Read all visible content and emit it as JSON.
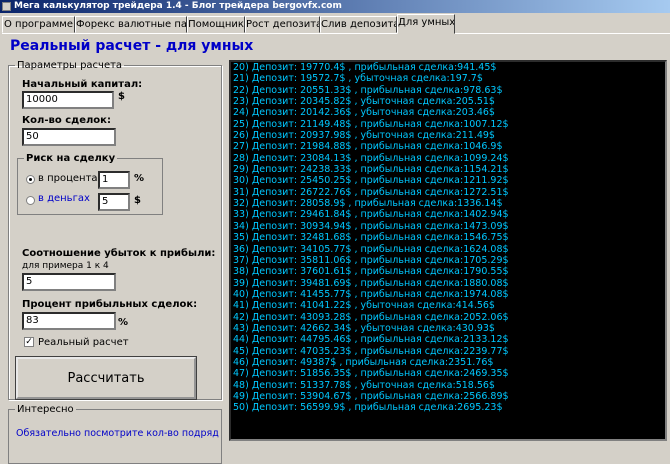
{
  "window": {
    "title": "Мега калькулятор трейдера 1.4 - Блог трейдера bergovfx.com"
  },
  "tabs": [
    {
      "label": "О программе"
    },
    {
      "label": "Форекс валютные пары"
    },
    {
      "label": "Помощник"
    },
    {
      "label": "Рост депозита"
    },
    {
      "label": "Слив депозита"
    },
    {
      "label": "Для умных"
    }
  ],
  "page": {
    "heading": "Реальный расчет - для умных"
  },
  "params": {
    "legend": "Параметры расчета",
    "capital_label": "Начальный капитал:",
    "capital_value": "10000",
    "capital_unit": "$",
    "trades_label": "Кол-во сделок:",
    "trades_value": "50",
    "risk": {
      "legend": "Риск на сделку",
      "percent_label": "в процентах",
      "percent_value": "1",
      "percent_unit": "%",
      "money_label": "в деньгах",
      "money_value": "5",
      "money_unit": "$",
      "selected": "percent"
    },
    "ratio_label": "Соотношение убыток к прибыли:",
    "ratio_hint": "для примера 1 к 4",
    "ratio_value": "5",
    "win_label": "Процент прибыльных сделок:",
    "win_value": "83",
    "win_unit": "%",
    "real_calc_label": "Реальный расчет",
    "real_calc_checked": true,
    "calc_button": "Рассчитать"
  },
  "info": {
    "legend": "Интересно",
    "link_text": "Обязательно посмотрите кол-во подряд"
  },
  "results": [
    "20) Депозит: 19770.4$ , прибыльная сделка:941.45$",
    "21) Депозит: 19572.7$ , убыточная сделка:197.7$",
    "22) Депозит: 20551.33$ , прибыльная сделка:978.63$",
    "23) Депозит: 20345.82$ , убыточная сделка:205.51$",
    "24) Депозит: 20142.36$ , убыточная сделка:203.46$",
    "25) Депозит: 21149.48$ , прибыльная сделка:1007.12$",
    "26) Депозит: 20937.98$ , убыточная сделка:211.49$",
    "27) Депозит: 21984.88$ , прибыльная сделка:1046.9$",
    "28) Депозит: 23084.13$ , прибыльная сделка:1099.24$",
    "29) Депозит: 24238.33$ , прибыльная сделка:1154.21$",
    "30) Депозит: 25450.25$ , прибыльная сделка:1211.92$",
    "31) Депозит: 26722.76$ , прибыльная сделка:1272.51$",
    "32) Депозит: 28058.9$ , прибыльная сделка:1336.14$",
    "33) Депозит: 29461.84$ , прибыльная сделка:1402.94$",
    "34) Депозит: 30934.94$ , прибыльная сделка:1473.09$",
    "35) Депозит: 32481.68$ , прибыльная сделка:1546.75$",
    "36) Депозит: 34105.77$ , прибыльная сделка:1624.08$",
    "37) Депозит: 35811.06$ , прибыльная сделка:1705.29$",
    "38) Депозит: 37601.61$ , прибыльная сделка:1790.55$",
    "39) Депозит: 39481.69$ , прибыльная сделка:1880.08$",
    "40) Депозит: 41455.77$ , прибыльная сделка:1974.08$",
    "41) Депозит: 41041.22$ , убыточная сделка:414.56$",
    "42) Депозит: 43093.28$ , прибыльная сделка:2052.06$",
    "43) Депозит: 42662.34$ , убыточная сделка:430.93$",
    "44) Депозит: 44795.46$ , прибыльная сделка:2133.12$",
    "45) Депозит: 47035.23$ , прибыльная сделка:2239.77$",
    "46) Депозит: 49387$ , прибыльная сделка:2351.76$",
    "47) Депозит: 51856.35$ , прибыльная сделка:2469.35$",
    "48) Депозит: 51337.78$ , убыточная сделка:518.56$",
    "49) Депозит: 53904.67$ , прибыльная сделка:2566.89$",
    "50) Депозит: 56599.9$ , прибыльная сделка:2695.23$"
  ]
}
